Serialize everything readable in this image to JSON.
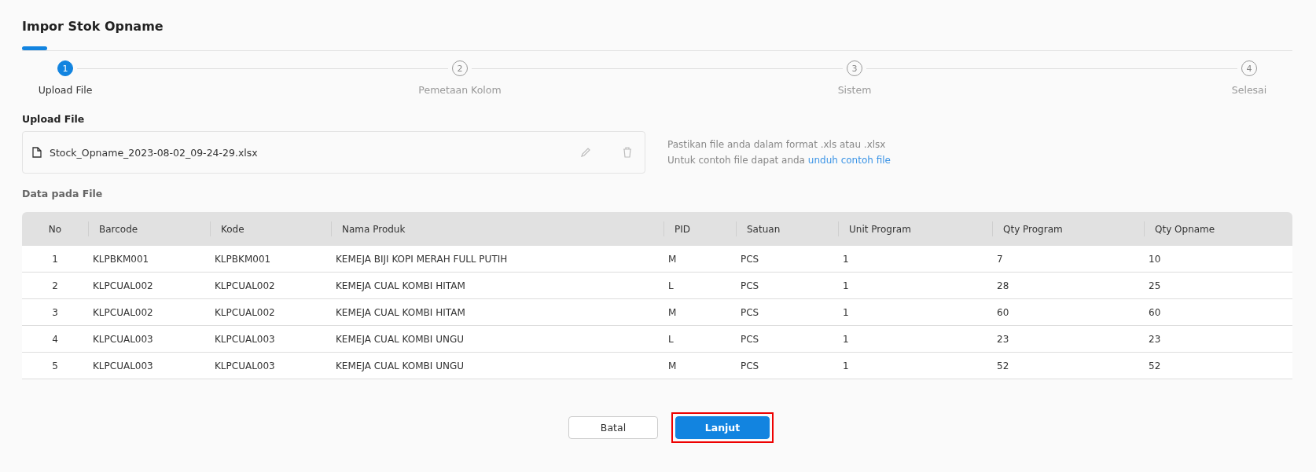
{
  "title": "Impor Stok Opname",
  "steps": [
    {
      "number": "1",
      "label": "Upload File",
      "selected": true
    },
    {
      "number": "2",
      "label": "Pemetaan Kolom",
      "selected": false
    },
    {
      "number": "3",
      "label": "Sistem",
      "selected": false
    },
    {
      "number": "4",
      "label": "Selesai",
      "selected": false
    }
  ],
  "upload": {
    "heading": "Upload File",
    "file_name": "Stock_Opname_2023-08-02_09-24-29.xlsx",
    "hint": "Pastikan file anda dalam format .xls atau .xlsx",
    "sample_text": "Untuk contoh file dapat anda",
    "sample_link": "unduh contoh file"
  },
  "data_heading": "Data pada File",
  "table": {
    "columns": [
      "No",
      "Barcode",
      "Kode",
      "Nama Produk",
      "PID",
      "Satuan",
      "Unit Program",
      "Qty Program",
      "Qty Opname"
    ],
    "rows": [
      [
        "1",
        "KLPBKM001",
        "KLPBKM001",
        "KEMEJA BIJI KOPI MERAH FULL PUTIH",
        "M",
        "PCS",
        "1",
        "7",
        "10"
      ],
      [
        "2",
        "KLPCUAL002",
        "KLPCUAL002",
        "KEMEJA CUAL KOMBI HITAM",
        "L",
        "PCS",
        "1",
        "28",
        "25"
      ],
      [
        "3",
        "KLPCUAL002",
        "KLPCUAL002",
        "KEMEJA CUAL KOMBI HITAM",
        "M",
        "PCS",
        "1",
        "60",
        "60"
      ],
      [
        "4",
        "KLPCUAL003",
        "KLPCUAL003",
        "KEMEJA CUAL KOMBI UNGU",
        "L",
        "PCS",
        "1",
        "23",
        "23"
      ],
      [
        "5",
        "KLPCUAL003",
        "KLPCUAL003",
        "KEMEJA CUAL KOMBI UNGU",
        "M",
        "PCS",
        "1",
        "52",
        "52"
      ]
    ]
  },
  "buttons": [
    {
      "label": "Batal",
      "kind": "secondary",
      "highlighted": false
    },
    {
      "label": "Lanjut",
      "kind": "primary",
      "highlighted": true
    }
  ]
}
